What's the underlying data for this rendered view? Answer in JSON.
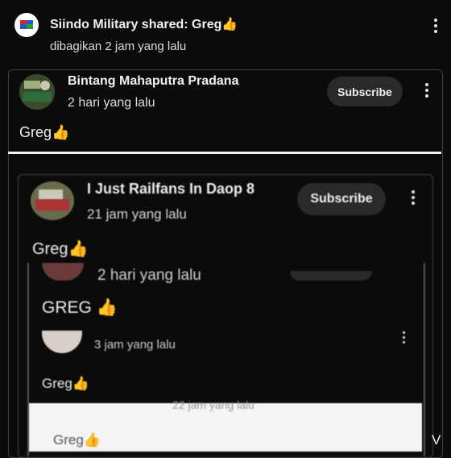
{
  "outer_post": {
    "header": "Siindo Military shared: Greg",
    "time": "dibagikan 2 jam yang lalu"
  },
  "card1": {
    "channel": "Bintang Mahaputra Pradana",
    "time": "2 hari yang lalu",
    "subscribe_label": "Subscribe",
    "body": "Greg"
  },
  "card2": {
    "channel": "I Just Railfans In Daop 8",
    "time": "21 jam yang lalu",
    "subscribe_label": "Subscribe",
    "body": "Greg"
  },
  "nested": {
    "time_a": "2 hari yang lalu",
    "body_a": "GREG",
    "time_b": "3 jam yang lalu",
    "body_b": "Greg",
    "time_c": "22 jam yang lalu",
    "body_c": "Greg",
    "edge_text": "V"
  },
  "icons": {
    "thumb": "thumbs-up-emoji-icon",
    "more": "three-dots-vertical-icon"
  }
}
